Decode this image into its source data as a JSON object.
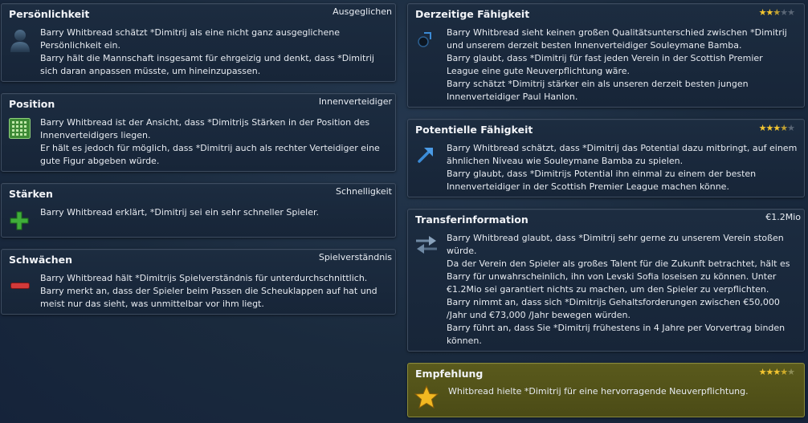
{
  "cards": {
    "personality": {
      "title": "Persönlichkeit",
      "tag": "Ausgeglichen",
      "lines": [
        "Barry Whitbread schätzt *Dimitrij als eine nicht ganz ausgeglichene Persönlichkeit ein.",
        "Barry hält die Mannschaft insgesamt für ehrgeizig und denkt, dass *Dimitrij sich daran anpassen müsste, um hineinzupassen."
      ]
    },
    "position": {
      "title": "Position",
      "tag": "Innenverteidiger",
      "lines": [
        "Barry Whitbread ist der Ansicht, dass *Dimitrijs Stärken in der Position des Innenverteidigers liegen.",
        "Er hält es jedoch für möglich, dass *Dimitrij auch als rechter Verteidiger eine gute Figur abgeben würde."
      ]
    },
    "strengths": {
      "title": "Stärken",
      "tag": "Schnelligkeit",
      "lines": [
        "Barry Whitbread erklärt, *Dimitrij sei ein sehr schneller Spieler."
      ]
    },
    "weaknesses": {
      "title": "Schwächen",
      "tag": "Spielverständnis",
      "lines": [
        "Barry Whitbread hält *Dimitrijs Spielverständnis für unterdurchschnittlich.",
        "Barry merkt an, dass der Spieler beim Passen die Scheuklappen auf hat und meist nur das sieht, was unmittelbar vor ihm liegt."
      ]
    },
    "current_ability": {
      "title": "Derzeitige Fähigkeit",
      "rating": 2.5,
      "lines": [
        "Barry Whitbread sieht keinen großen Qualitätsunterschied zwischen *Dimitrij und unserem derzeit besten Innenverteidiger Souleymane Bamba.",
        "Barry glaubt, dass *Dimitrij für fast jeden Verein in der Scottish Premier League eine gute Neuverpflichtung wäre.",
        "Barry schätzt *Dimitrij stärker ein als unseren derzeit besten jungen Innenverteidiger Paul Hanlon."
      ]
    },
    "potential_ability": {
      "title": "Potentielle Fähigkeit",
      "rating": 3.5,
      "lines": [
        "Barry Whitbread schätzt, dass *Dimitrij das Potential dazu mitbringt, auf einem ähnlichen Niveau wie Souleymane Bamba zu spielen.",
        "Barry glaubt, dass *Dimitrijs Potential ihn einmal zu einem der besten Innenverteidiger in der Scottish Premier League machen könne."
      ]
    },
    "transfer": {
      "title": "Transferinformation",
      "tag": "€1.2Mio",
      "lines": [
        "Barry Whitbread glaubt, dass *Dimitrij sehr gerne zu unserem Verein stoßen würde.",
        "Da der Verein den Spieler als großes Talent für die Zukunft betrachtet, hält es Barry für unwahrscheinlich, ihn von Levski Sofia loseisen zu können. Unter €1.2Mio sei garantiert nichts zu machen, um den Spieler zu verpflichten.",
        "Barry nimmt an, dass sich *Dimitrijs Gehaltsforderungen zwischen €50,000 /Jahr und €73,000 /Jahr bewegen würden.",
        "Barry führt an, dass Sie *Dimitrij frühestens in 4 Jahre per Vorvertrag binden können."
      ]
    },
    "recommendation": {
      "title": "Empfehlung",
      "rating": 3.5,
      "lines": [
        "Whitbread hielte *Dimitrij für eine hervorragende Neuverpflichtung."
      ]
    }
  },
  "icons": {
    "personality": "person-silhouette-icon",
    "position": "pitch-grid-icon",
    "strengths": "plus-icon",
    "weaknesses": "minus-icon",
    "current_ability": "dot-arrow-icon",
    "potential_ability": "arrow-up-right-icon",
    "transfer": "transfer-arrows-icon",
    "recommendation": "star-icon"
  },
  "colors": {
    "star": "#f4c630",
    "plus": "#3fae3a",
    "minus": "#d23a3a",
    "recommendation_bg": "#53531a"
  }
}
